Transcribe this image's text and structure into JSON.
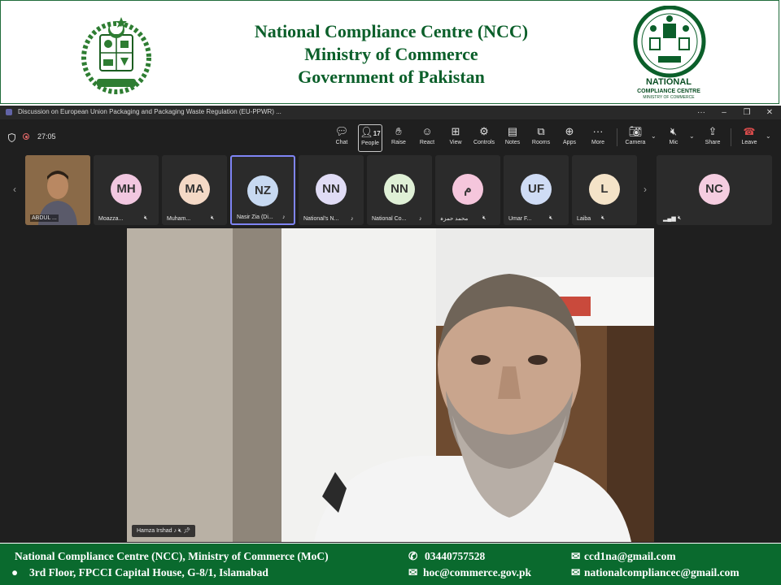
{
  "header": {
    "title_line1": "National Compliance Centre (NCC)",
    "title_line2": "Ministry of Commerce",
    "title_line3": "Government of Pakistan",
    "logo_name": "NATIONAL",
    "logo_sub": "COMPLIANCE CENTRE",
    "logo_sub2": "MINISTRY OF COMMERCE",
    "brand_color": "#0b5f2a"
  },
  "teams": {
    "window_title": "Discussion on European Union Packaging and Packaging Waste Regulation (EU-PPWR) ...",
    "timer": "27:05",
    "toolbar": {
      "chat": "Chat",
      "people": "People",
      "people_count": "17",
      "raise": "Raise",
      "react": "React",
      "view": "View",
      "controls": "Controls",
      "notes": "Notes",
      "rooms": "Rooms",
      "apps": "Apps",
      "more": "More",
      "camera": "Camera",
      "mic": "Mic",
      "share": "Share",
      "leave": "Leave"
    },
    "participants": [
      {
        "initials": "",
        "name": "ABDUL ...",
        "color": ""
      },
      {
        "initials": "MH",
        "name": "Moazza...",
        "color": "#f1c7e0"
      },
      {
        "initials": "MA",
        "name": "Muham...",
        "color": "#f4d9c6"
      },
      {
        "initials": "NZ",
        "name": "Nasir Zia (Di...",
        "color": "#c7d9f1"
      },
      {
        "initials": "NN",
        "name": "National's N...",
        "color": "#e0dcf5"
      },
      {
        "initials": "NN",
        "name": "National Co...",
        "color": "#dff0d6"
      },
      {
        "initials": "م",
        "name": "محمد حمزہ",
        "color": "#f5c6dc"
      },
      {
        "initials": "UF",
        "name": "Umar F...",
        "color": "#cfdcf5"
      },
      {
        "initials": "L",
        "name": "Laiba",
        "color": "#f4e3c8"
      },
      {
        "initials": "NC",
        "name": "",
        "color": "#f5cde0"
      }
    ],
    "main_speaker": "Hamza Irshad"
  },
  "footer": {
    "org": "National Compliance Centre (NCC),  Ministry of Commerce (MoC)",
    "address": "3rd Floor, FPCCI Capital House, G-8/1, Islamabad",
    "phone": "03440757528",
    "email1": "hoc@commerce.gov.pk",
    "email2": "ccd1na@gmail.com",
    "email3": "nationalcompliancec@gmail.com"
  }
}
